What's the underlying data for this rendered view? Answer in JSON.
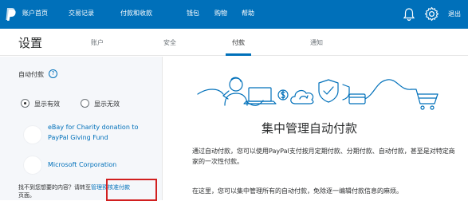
{
  "nav": {
    "items": [
      "账户首页",
      "交易记录",
      "付款和收款",
      "钱包",
      "购物",
      "帮助"
    ],
    "logout": "退出",
    "colors": {
      "bar": "#0070ba",
      "text": "#ffffff"
    },
    "icons": [
      "paypal-logo-icon",
      "bell-icon",
      "gear-icon"
    ]
  },
  "settings": {
    "title": "设置",
    "tabs": [
      "账户",
      "安全",
      "付款",
      "通知"
    ],
    "active_tab": "付款"
  },
  "left_panel": {
    "title": "自动付款",
    "help_glyph": "?",
    "radios": [
      {
        "label": "显示有效",
        "selected": true
      },
      {
        "label": "显示无效",
        "selected": false
      }
    ],
    "merchants": [
      {
        "name": "eBay for Charity donation to PayPal Giving Fund"
      },
      {
        "name": "Microsoft Corporation"
      }
    ],
    "footer": {
      "prefix": "找不到您想要的内容？请转至",
      "link": "管理预核准付款",
      "suffix": "页面。"
    }
  },
  "main": {
    "heading": "集中管理自动付款",
    "paragraphs": [
      "通过自动付款，您可以使用PayPal支付按月定期付款、分期付款、自动付款，甚至是对特定商家的一次性付款。",
      "在这里，您可以集中管理所有的自动付款，免除逐一编辑付款信息的麻烦。"
    ]
  }
}
